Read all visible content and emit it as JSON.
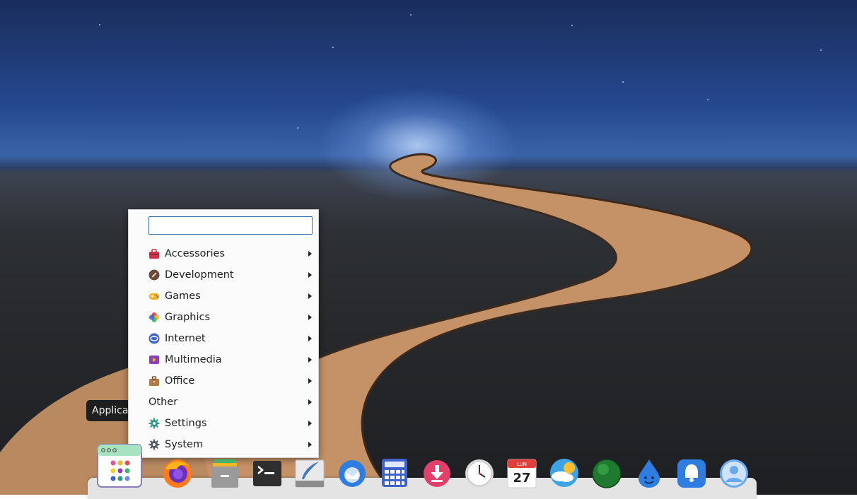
{
  "tooltip": {
    "text": "Applicazioni"
  },
  "menu": {
    "search": {
      "value": "",
      "placeholder": ""
    },
    "items": [
      {
        "label": "Accessories",
        "icon": "toolbox-icon",
        "color": "#c8364b"
      },
      {
        "label": "Development",
        "icon": "hammer-icon",
        "color": "#6b4a3c"
      },
      {
        "label": "Games",
        "icon": "gamepad-icon",
        "color": "#f2b526"
      },
      {
        "label": "Graphics",
        "icon": "color-wheel-icon",
        "color": "#e94fa0"
      },
      {
        "label": "Internet",
        "icon": "globe-icon",
        "color": "#3f63c8"
      },
      {
        "label": "Multimedia",
        "icon": "media-player-icon",
        "color": "#8a3fbf"
      },
      {
        "label": "Office",
        "icon": "briefcase-icon",
        "color": "#b07a44"
      },
      {
        "label": "Other",
        "icon": "",
        "color": ""
      },
      {
        "label": "Settings",
        "icon": "settings-gear-icon",
        "color": "#2c9c85"
      },
      {
        "label": "System",
        "icon": "system-gear-icon",
        "color": "#545a63"
      }
    ]
  },
  "dock": {
    "apps": [
      {
        "name": "app-grid-icon"
      },
      {
        "name": "firefox-icon"
      },
      {
        "name": "file-manager-icon"
      },
      {
        "name": "terminal-icon"
      },
      {
        "name": "text-editor-icon"
      },
      {
        "name": "thunderbird-icon"
      },
      {
        "name": "calculator-icon"
      },
      {
        "name": "downloader-icon"
      },
      {
        "name": "clock-icon"
      },
      {
        "name": "calendar-icon",
        "month": "LUN",
        "day": "27"
      },
      {
        "name": "weather-icon"
      },
      {
        "name": "green-sphere-icon"
      },
      {
        "name": "water-drop-icon"
      },
      {
        "name": "notifications-bell-icon"
      },
      {
        "name": "user-account-icon"
      }
    ]
  }
}
